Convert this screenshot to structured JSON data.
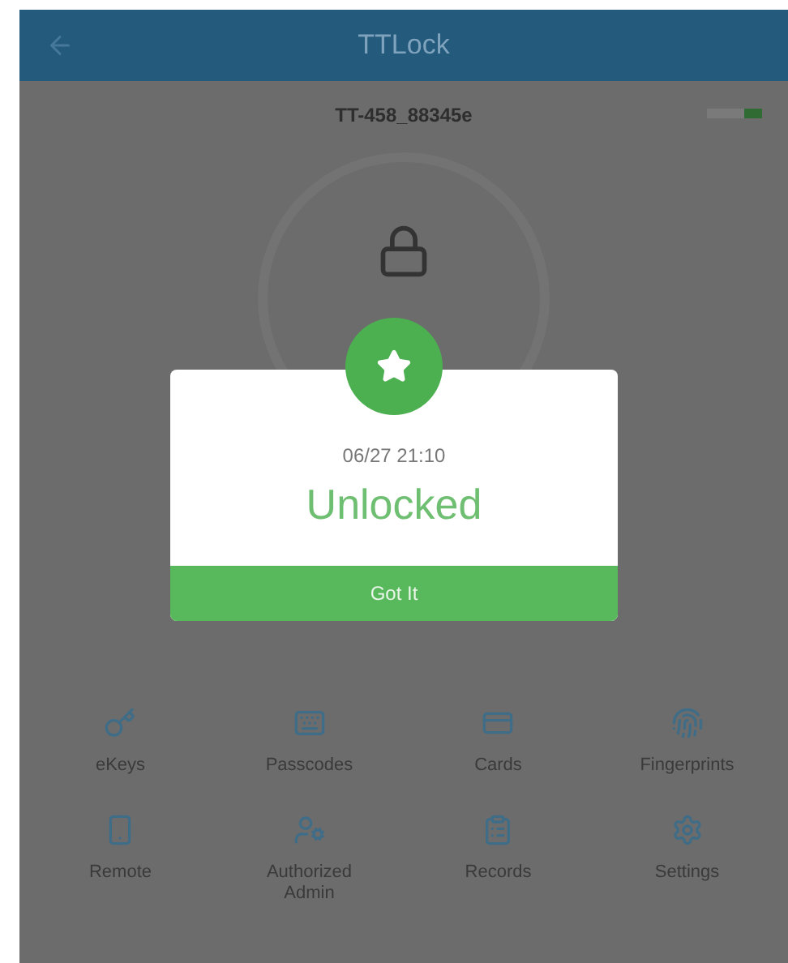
{
  "header": {
    "title": "TTLock"
  },
  "lock": {
    "name": "TT-458_88345e"
  },
  "dialog": {
    "time": "06/27 21:10",
    "status": "Unlocked",
    "button": "Got It"
  },
  "features": [
    {
      "kind": "ekeys",
      "label": "eKeys"
    },
    {
      "kind": "passcodes",
      "label": "Passcodes"
    },
    {
      "kind": "cards",
      "label": "Cards"
    },
    {
      "kind": "fingerprints",
      "label": "Fingerprints"
    },
    {
      "kind": "remote",
      "label": "Remote"
    },
    {
      "kind": "admin",
      "label": "Authorized Admin"
    },
    {
      "kind": "records",
      "label": "Records"
    },
    {
      "kind": "settings",
      "label": "Settings"
    }
  ]
}
